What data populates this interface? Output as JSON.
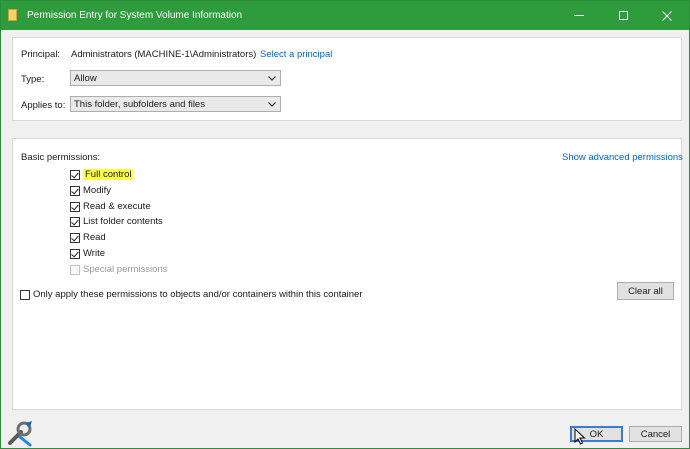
{
  "window": {
    "title": "Permission Entry for System Volume Information",
    "controls": {
      "minimize": "minimize",
      "maximize": "maximize",
      "close": "close"
    }
  },
  "principal": {
    "label": "Principal:",
    "value": "Administrators (MACHINE-1\\Administrators)",
    "link": "Select a principal"
  },
  "type": {
    "label": "Type:",
    "selected": "Allow"
  },
  "applies_to": {
    "label": "Applies to:",
    "selected": "This folder, subfolders and files"
  },
  "basic_permissions": {
    "label": "Basic permissions:",
    "advanced_link": "Show advanced permissions",
    "items": [
      {
        "label": "Full control",
        "checked": true,
        "disabled": false,
        "highlighted": true
      },
      {
        "label": "Modify",
        "checked": true,
        "disabled": false
      },
      {
        "label": "Read & execute",
        "checked": true,
        "disabled": false
      },
      {
        "label": "List folder contents",
        "checked": true,
        "disabled": false
      },
      {
        "label": "Read",
        "checked": true,
        "disabled": false
      },
      {
        "label": "Write",
        "checked": true,
        "disabled": false
      },
      {
        "label": "Special permissions",
        "checked": false,
        "disabled": true
      }
    ]
  },
  "only_apply": {
    "label": "Only apply these permissions to objects and/or containers within this container",
    "checked": false
  },
  "buttons": {
    "clear_all": "Clear all",
    "ok": "OK",
    "cancel": "Cancel"
  },
  "colors": {
    "titlebar": "#2e9b3d",
    "link": "#0066cc",
    "highlight": "#ffff44"
  }
}
